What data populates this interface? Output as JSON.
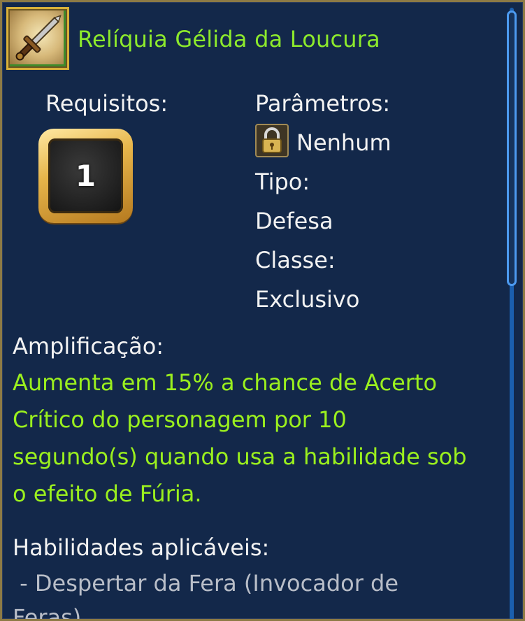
{
  "item": {
    "title": "Relíquia Gélida da Loucura",
    "icon": "dagger-relic-icon"
  },
  "requirements": {
    "label": "Requisitos:",
    "level": "1"
  },
  "parameters": {
    "label": "Parâmetros:",
    "lock_icon": "padlock-icon",
    "value": "Nenhum",
    "type_label": "Tipo:",
    "type_value": "Defesa",
    "class_label": "Classe:",
    "class_value": "Exclusivo"
  },
  "amplification": {
    "label": "Amplificação:",
    "lines": [
      "Aumenta em 15% a chance de Acerto",
      "Crítico do personagem por 10",
      "segundo(s) quando usa a habilidade sob",
      "o efeito de Fúria."
    ]
  },
  "applicable_skills": {
    "label": "Habilidades aplicáveis:",
    "lines": [
      " - Despertar da Fera (Invocador de",
      "Feras)"
    ]
  },
  "colors": {
    "panel_bg": "#13284a",
    "border_gold": "#8d7a45",
    "title_green": "#8dea2c",
    "effect_green": "#9bf01e",
    "text_white": "#f2f2f2",
    "scroll_blue": "#4c9af0"
  }
}
